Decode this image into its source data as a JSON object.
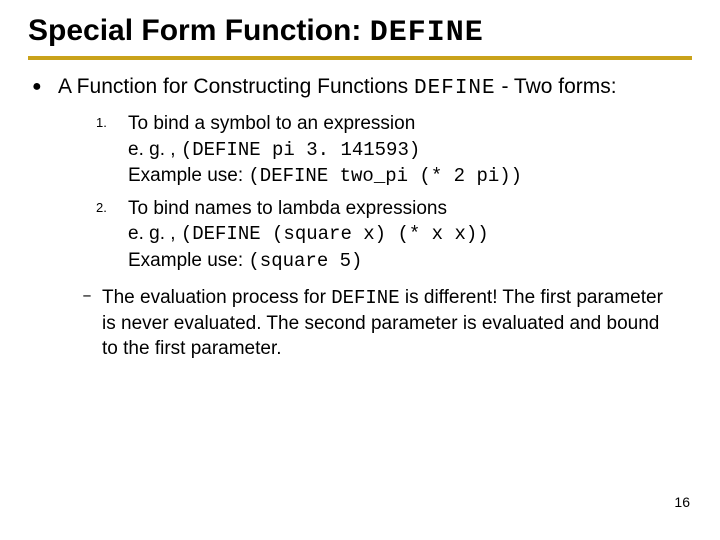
{
  "title": {
    "prefix": "Special Form Function: ",
    "code": "DEFINE"
  },
  "lead": {
    "before": "A Function for Constructing Functions ",
    "code": "DEFINE",
    "after": " - Two forms:"
  },
  "items": [
    {
      "num": "1.",
      "l1": "To bind a symbol to an expression",
      "eg_label": "e. g. , ",
      "eg_code": "(DEFINE pi 3. 141593)",
      "ex_label": "Example use: ",
      "ex_code": "(DEFINE two_pi (* 2 pi))"
    },
    {
      "num": "2.",
      "l1": "To bind names to lambda expressions",
      "eg_label": "e. g. , ",
      "eg_code": "(DEFINE (square x) (* x x))",
      "ex_label": "Example use: ",
      "ex_code": "(square 5)"
    }
  ],
  "note": {
    "dash": "–",
    "before": "The evaluation process for ",
    "code": "DEFINE",
    "after": " is different! The first parameter is never evaluated. The second parameter is evaluated and bound to the first parameter."
  },
  "page": "16"
}
